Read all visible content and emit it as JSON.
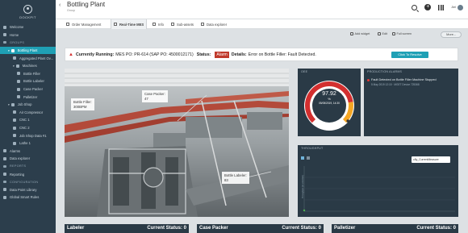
{
  "app": {
    "logo_text": "DOCKPIT",
    "title": "Bottling Plant",
    "subtitle": "Group",
    "user_name": "Jiel"
  },
  "sidebar": {
    "items": [
      {
        "label": "Welcome",
        "level": 0,
        "kind": "item"
      },
      {
        "label": "Home",
        "level": 0,
        "kind": "item"
      },
      {
        "label": "GROUPS",
        "level": 0,
        "kind": "section"
      },
      {
        "label": "Bottling Plant",
        "level": 1,
        "kind": "active"
      },
      {
        "label": "Aggregated Plant Ov...",
        "level": 2,
        "kind": "item"
      },
      {
        "label": "Machines",
        "level": 2,
        "kind": "group"
      },
      {
        "label": "Bottle Filler",
        "level": 3,
        "kind": "item"
      },
      {
        "label": "Bottle Labeler",
        "level": 3,
        "kind": "item"
      },
      {
        "label": "Case Packer",
        "level": 3,
        "kind": "item"
      },
      {
        "label": "Palletizer",
        "level": 3,
        "kind": "item"
      },
      {
        "label": "Job Shop",
        "level": 1,
        "kind": "group"
      },
      {
        "label": "Air Compressor",
        "level": 2,
        "kind": "item"
      },
      {
        "label": "CNC 1",
        "level": 2,
        "kind": "item"
      },
      {
        "label": "CNC 2",
        "level": 2,
        "kind": "item"
      },
      {
        "label": "Job Shop Data #1",
        "level": 2,
        "kind": "item"
      },
      {
        "label": "Lathe 1",
        "level": 2,
        "kind": "item"
      },
      {
        "label": "Alarms",
        "level": 0,
        "kind": "item"
      },
      {
        "label": "Data explorer",
        "level": 0,
        "kind": "item"
      },
      {
        "label": "REPORTS",
        "level": 0,
        "kind": "section"
      },
      {
        "label": "Reporting",
        "level": 0,
        "kind": "item"
      },
      {
        "label": "CONFIGURATION",
        "level": 0,
        "kind": "section"
      },
      {
        "label": "Data Point Library",
        "level": 0,
        "kind": "item"
      },
      {
        "label": "Global Smart Rules",
        "level": 0,
        "kind": "item"
      }
    ]
  },
  "tabs": [
    {
      "label": "Order Management"
    },
    {
      "label": "Real-Time MES"
    },
    {
      "label": "Info"
    },
    {
      "label": "Sub-assets"
    },
    {
      "label": "Data explorer"
    }
  ],
  "toolbar": {
    "add_widget": "Add widget",
    "edit": "Edit",
    "full_screen": "Full screen",
    "more": "More..."
  },
  "banner": {
    "running_label": "Currently Running:",
    "running_value": "MES PO: PR-614 (SAP PO: 4500012171)",
    "status_label": "Status:",
    "status_value": "Alarm",
    "details_label": "Details:",
    "details_value": "Error on Bottle Filler: Fault Detected.",
    "resolve_label": "Click To Resolve"
  },
  "factory": {
    "labels": [
      {
        "text": "Bottle Filler:\n300BPM"
      },
      {
        "text": "Case Packer:\n47"
      },
      {
        "text": "Bottle Labeler:\n83"
      }
    ]
  },
  "oee": {
    "title": "OEE",
    "value": "97.92",
    "unit": "%",
    "date": "05/05/2019, 14:30",
    "gauge_fraction": 0.979,
    "colors": {
      "red": "#d32f2f",
      "orange": "#f5a623",
      "track": "#ffffff"
    }
  },
  "alarms": {
    "title": "PRODUCTION ALARMS",
    "item_text": "Fault Detected on Bottle Filler Machine Stopped",
    "item_meta": "5 May 2019 12:15 · MGET Device 725368"
  },
  "throughput": {
    "title": "THROUGHPUT",
    "select_value": "c8y_CurrentMeasure",
    "y_axis_label": "Throughput (in units/min)"
  },
  "bottom": [
    {
      "name": "Labeler",
      "status": "Current Status: 0"
    },
    {
      "name": "Case Packer",
      "status": "Current Status: 0"
    },
    {
      "name": "Palletizer",
      "status": "Current Status: 0"
    }
  ]
}
